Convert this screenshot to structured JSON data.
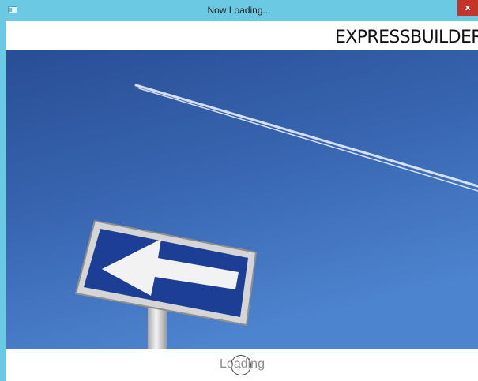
{
  "window": {
    "title": "Now Loading...",
    "close_label": "x",
    "titlebar_color": "#6cc9e4",
    "close_color": "#c4342b"
  },
  "brand": {
    "name": "EXPRESSBUILDER"
  },
  "hero": {
    "icon": "one-way-arrow-sign-icon",
    "sky_color": "#3a63a8"
  },
  "status": {
    "text": "Loading",
    "icon": "spinner-icon"
  }
}
